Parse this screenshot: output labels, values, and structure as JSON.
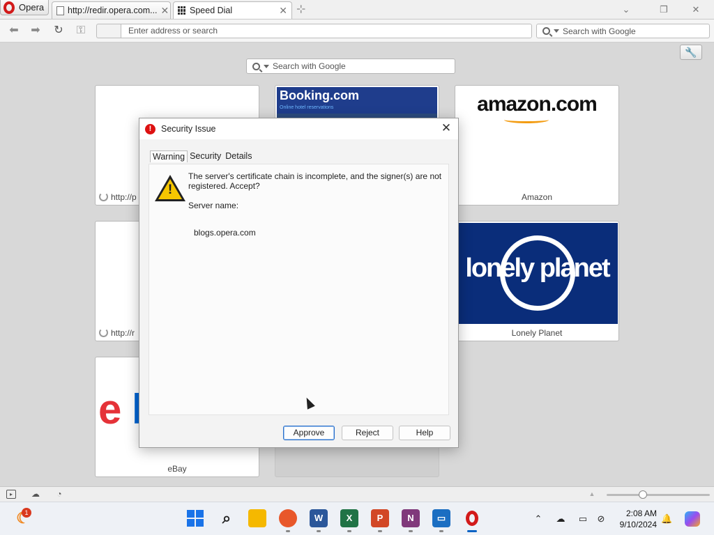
{
  "browser": {
    "menu_label": "Opera",
    "tabs": [
      {
        "title": "http://redir.opera.com..."
      },
      {
        "title": "Speed Dial"
      }
    ],
    "address_placeholder": "Enter address or search",
    "search_placeholder": "Search with Google"
  },
  "speed_dial": {
    "search_placeholder": "Search with Google",
    "tiles": [
      {
        "label": "http://p"
      },
      {
        "label": "Booking.com",
        "tagline": "Online hotel reservations"
      },
      {
        "label": "Amazon",
        "logo": "amazon.com"
      },
      {
        "label": "http://r"
      },
      {
        "label": "Lonely Planet",
        "logo": "lonely planet"
      },
      {
        "label": "eBay",
        "logo": "eb"
      }
    ]
  },
  "dialog": {
    "title": "Security Issue",
    "tabs": [
      "Warning",
      "Security",
      "Details"
    ],
    "message": "The server's certificate chain is incomplete, and the signer(s) are not registered. Accept?",
    "server_name_label": "Server name:",
    "server_name_value": "blogs.opera.com",
    "buttons": {
      "approve": "Approve",
      "reject": "Reject",
      "help": "Help"
    }
  },
  "taskbar": {
    "notification_count": "1",
    "time": "2:08 AM",
    "date": "9/10/2024"
  },
  "colors": {
    "opera_red": "#d21a1a",
    "booking_blue": "#1f3d8c",
    "lonely_planet_blue": "#0a2d7a",
    "default_button_border": "#2a6fc9"
  }
}
